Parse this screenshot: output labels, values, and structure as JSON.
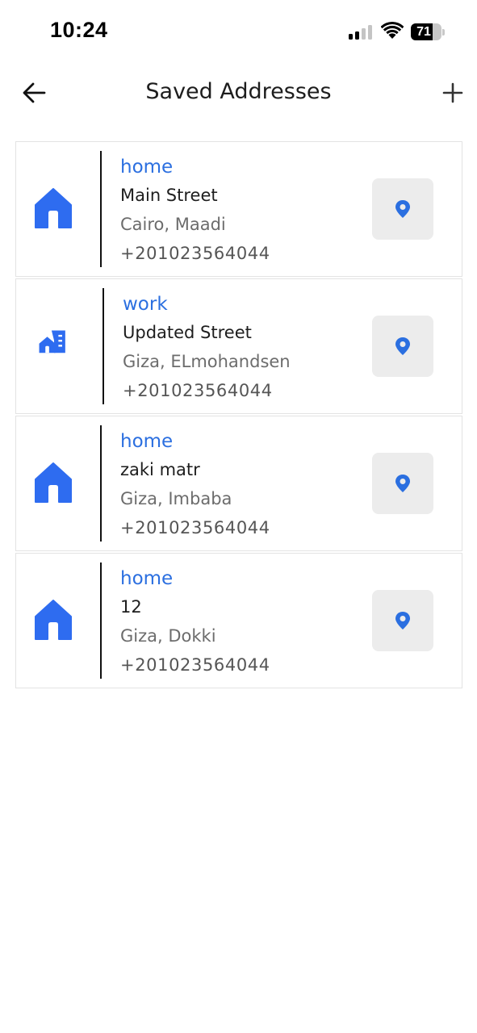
{
  "status_bar": {
    "time": "10:24",
    "battery_level": "71"
  },
  "header": {
    "title": "Saved Addresses",
    "back_icon": "arrow-left-icon",
    "add_icon": "plus-icon"
  },
  "colors": {
    "accent": "#2b6fe0",
    "map_button_bg": "#ececec",
    "secondary_text": "#6c6c6c"
  },
  "addresses": [
    {
      "type_icon": "home-icon",
      "label": "home",
      "street": "Main Street",
      "city": "Cairo, Maadi",
      "phone": "+201023564044"
    },
    {
      "type_icon": "work-building-icon",
      "label": "work",
      "street": "Updated Street",
      "city": "Giza, ELmohandsen",
      "phone": "+201023564044"
    },
    {
      "type_icon": "home-icon",
      "label": "home",
      "street": "zaki matr",
      "city": "Giza, Imbaba",
      "phone": "+201023564044"
    },
    {
      "type_icon": "home-icon",
      "label": "home",
      "street": "12",
      "city": "Giza, Dokki",
      "phone": "+201023564044"
    }
  ]
}
